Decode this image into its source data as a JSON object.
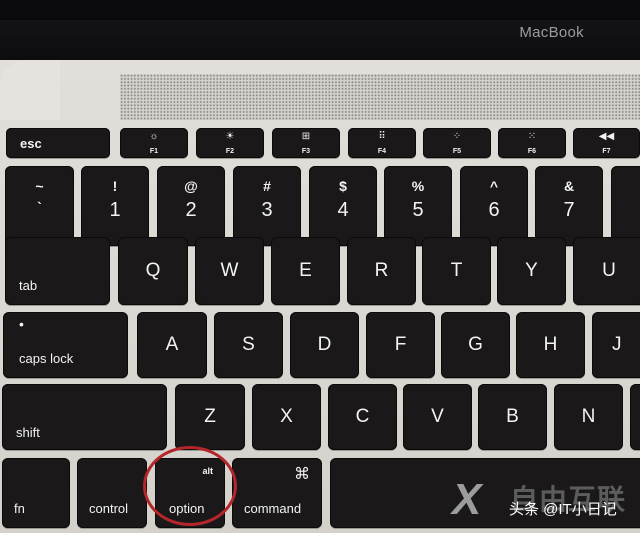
{
  "photo": {
    "subject": "MacBook keyboard",
    "brand_label": "MacBook",
    "highlight_color": "#b3262a",
    "highlighted_key": "option"
  },
  "function_row": [
    {
      "label": "esc"
    },
    {
      "icon": "brightness-down-icon",
      "glyph": "☼",
      "fn": "F1"
    },
    {
      "icon": "brightness-up-icon",
      "glyph": "☀",
      "fn": "F2"
    },
    {
      "icon": "mission-control-icon",
      "glyph": "⊞",
      "fn": "F3"
    },
    {
      "icon": "launchpad-icon",
      "glyph": "⠿",
      "fn": "F4"
    },
    {
      "icon": "keyboard-backlight-down-icon",
      "glyph": "⁘",
      "fn": "F5"
    },
    {
      "icon": "keyboard-backlight-up-icon",
      "glyph": "⁙",
      "fn": "F6"
    },
    {
      "icon": "rewind-icon",
      "glyph": "◀◀",
      "fn": "F7"
    }
  ],
  "number_row": [
    {
      "top": "~",
      "bottom": "`"
    },
    {
      "top": "!",
      "bottom": "1"
    },
    {
      "top": "@",
      "bottom": "2"
    },
    {
      "top": "#",
      "bottom": "3"
    },
    {
      "top": "$",
      "bottom": "4"
    },
    {
      "top": "%",
      "bottom": "5"
    },
    {
      "top": "^",
      "bottom": "6"
    },
    {
      "top": "&",
      "bottom": "7"
    }
  ],
  "qwerty_row": {
    "modifier": "tab",
    "letters": [
      "Q",
      "W",
      "E",
      "R",
      "T",
      "Y",
      "U"
    ]
  },
  "home_row": {
    "modifier": "caps lock",
    "indicator": "•",
    "letters": [
      "A",
      "S",
      "D",
      "F",
      "G",
      "H",
      "J"
    ]
  },
  "bottom_letter_row": {
    "modifier": "shift",
    "letters": [
      "Z",
      "X",
      "C",
      "V",
      "B",
      "N"
    ]
  },
  "space_row": {
    "fn": "fn",
    "control": "control",
    "option_top": "alt",
    "option": "option",
    "command_symbol": "⌘",
    "command": "command"
  },
  "watermark": {
    "logo": "X",
    "brand": "自由互联",
    "credit": "头条 @IT小日记"
  }
}
